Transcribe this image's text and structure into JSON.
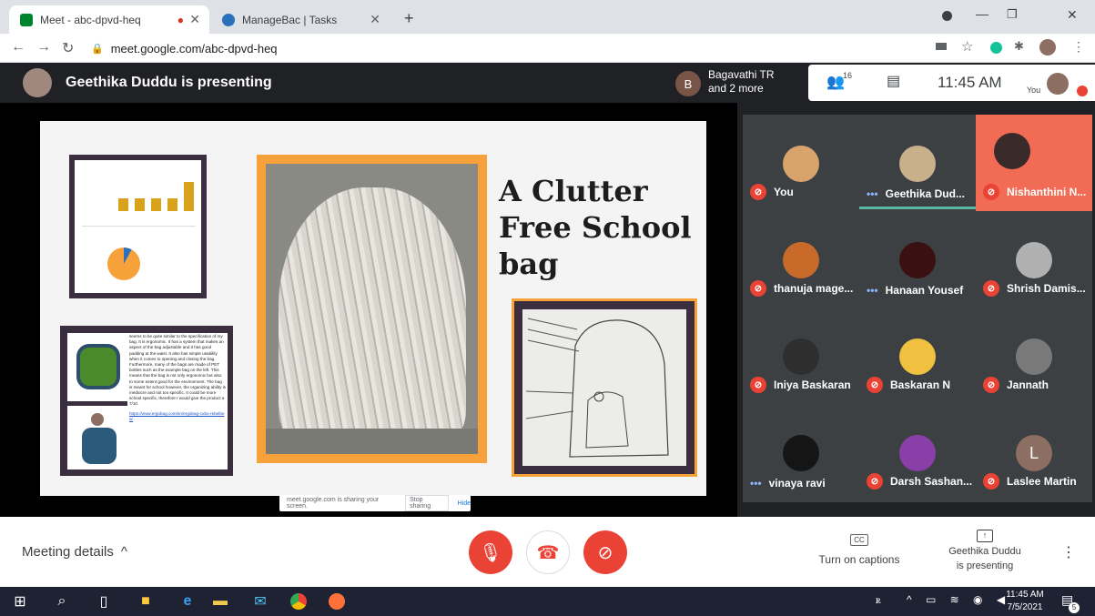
{
  "browser": {
    "tabs": [
      {
        "label": "Meet - abc-dpvd-heq",
        "icon": "meet-icon"
      },
      {
        "label": "ManageBac | Tasks",
        "icon": "managebac-icon"
      }
    ],
    "url": "meet.google.com/abc-dpvd-heq"
  },
  "meet": {
    "presenting_title": "Geethika Duddu is presenting",
    "host_initial": "B",
    "host_line1": "Bagavathi TR",
    "host_line2": "and 2 more",
    "people_count": "16",
    "time": "11:45 AM",
    "you_label": "You"
  },
  "slide": {
    "title_line1": "A Clutter",
    "title_line2": "Free School",
    "title_line3": "bag",
    "paragraph": "seems to be quite similar to the specification of my bag. It is ergonomic. It has a system that makes an aspect of the bag adjustable and it has good padding at the waist. It also has simple usability when it comes to opening and closing the bag. Furthermore, many of the bags are made of PET bottles such as the example bag on the left. This means that the bag is not only ergonomic but also to some extent good for the environment. The bag is meant for school however, the organizing ability is mediocre and not too specific. It could be more school specific, therefore I would give the product a 7/10.",
    "link": "https://www.ergobag.com/en/ergobag-cubo-rebelbear"
  },
  "share_notice": {
    "text": "meet.google.com is sharing your screen.",
    "stop": "Stop sharing",
    "hide": "Hide"
  },
  "participants": [
    {
      "name": "You",
      "status": "muted"
    },
    {
      "name": "Geethika Dud...",
      "status": "speaking"
    },
    {
      "name": "Nishanthini N...",
      "status": "muted"
    },
    {
      "name": "thanuja mage...",
      "status": "muted"
    },
    {
      "name": "Hanaan Yousef",
      "status": "speaking"
    },
    {
      "name": "Shrish Damis...",
      "status": "muted"
    },
    {
      "name": "Iniya Baskaran",
      "status": "muted"
    },
    {
      "name": "Baskaran N",
      "status": "muted"
    },
    {
      "name": "Jannath",
      "status": "muted"
    },
    {
      "name": "vinaya ravi",
      "status": "speaking"
    },
    {
      "name": "Darsh Sashan...",
      "status": "muted"
    },
    {
      "name": "Laslee Martin",
      "status": "muted",
      "initial": "L"
    }
  ],
  "bottom": {
    "meeting_details": "Meeting details",
    "captions": "Turn on captions",
    "cc": "CC",
    "presenting_line1": "Geethika Duddu",
    "presenting_line2": "is presenting"
  },
  "taskbar": {
    "time": "11:45 AM",
    "date": "7/5/2021",
    "notif_count": "5"
  },
  "colors": {
    "meet_red": "#ea4335",
    "accent_teal": "#5bb7a6",
    "avatar_brown": "#795548"
  }
}
